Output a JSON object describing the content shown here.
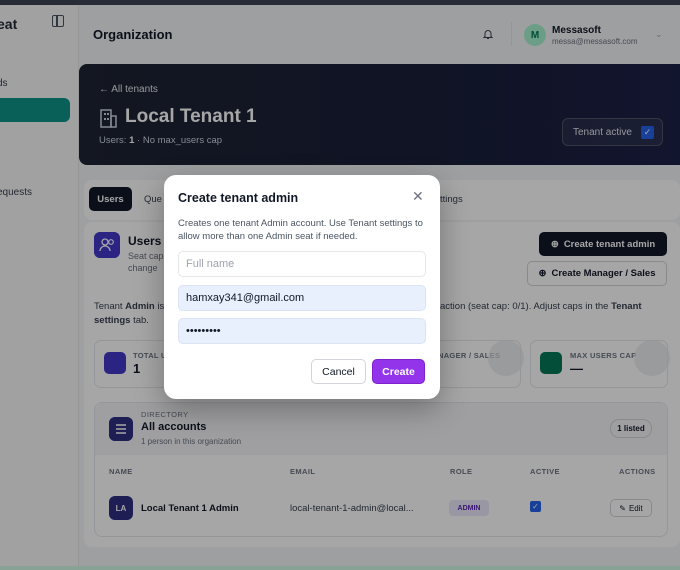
{
  "sidebar": {
    "brand": "eat",
    "items": [
      {
        "label": "ds"
      },
      {
        "label": ""
      },
      {
        "label": "equests"
      }
    ]
  },
  "header": {
    "title": "Organization",
    "user_initial": "M",
    "user_name": "Messasoft",
    "user_email": "messa@messasoft.com"
  },
  "hero": {
    "back_label": "All tenants",
    "title": "Local Tenant 1",
    "users_label": "Users:",
    "users_count": "1",
    "users_suffix": "· No max_users cap",
    "active_label": "Tenant active",
    "active_checked": true
  },
  "tabs": {
    "users": "Users",
    "queue": "Que",
    "settings": "ttings"
  },
  "users_section": {
    "title": "Users o",
    "desc1": "Seat cap",
    "desc2": "change",
    "create_admin_label": "Create tenant admin",
    "create_mgr_label": "Create Manager / Sales",
    "info_prefix": "Tenant",
    "info_bold": "Admin",
    "info_mid": "is",
    "info_right": "action (seat cap: 0/1). Adjust caps in the",
    "info_right_bold": "Tenant",
    "info_line2_bold": "settings",
    "info_line2_rest": "tab."
  },
  "stats": [
    {
      "label": "TOTAL U",
      "value": "1",
      "color": "#4338ca"
    },
    {
      "label": "NAGER / SALES",
      "value": "",
      "color": "#e5e7eb"
    },
    {
      "label": "MAX USERS CAP",
      "value": "—",
      "color": "#047857"
    }
  ],
  "directory": {
    "kicker": "DIRECTORY",
    "title": "All accounts",
    "subtitle": "1 person in this organization",
    "listed_label": "1 listed",
    "columns": [
      "NAME",
      "EMAIL",
      "ROLE",
      "ACTIVE",
      "ACTIONS"
    ],
    "rows": [
      {
        "initials": "LA",
        "name": "Local Tenant 1 Admin",
        "email": "local-tenant-1-admin@local...",
        "role": "ADMIN",
        "active": true,
        "action": "Edit"
      }
    ]
  },
  "modal": {
    "title": "Create tenant admin",
    "description": "Creates one tenant Admin account. Use Tenant settings to allow more than one Admin seat if needed.",
    "full_name_placeholder": "Full name",
    "full_name_value": "",
    "email_value": "hamxay341@gmail.com",
    "password_value": "abcdefghi",
    "cancel_label": "Cancel",
    "create_label": "Create"
  },
  "colors": {
    "accent_purple": "#9333ea",
    "teal": "#0d9488",
    "dark": "#111827"
  }
}
